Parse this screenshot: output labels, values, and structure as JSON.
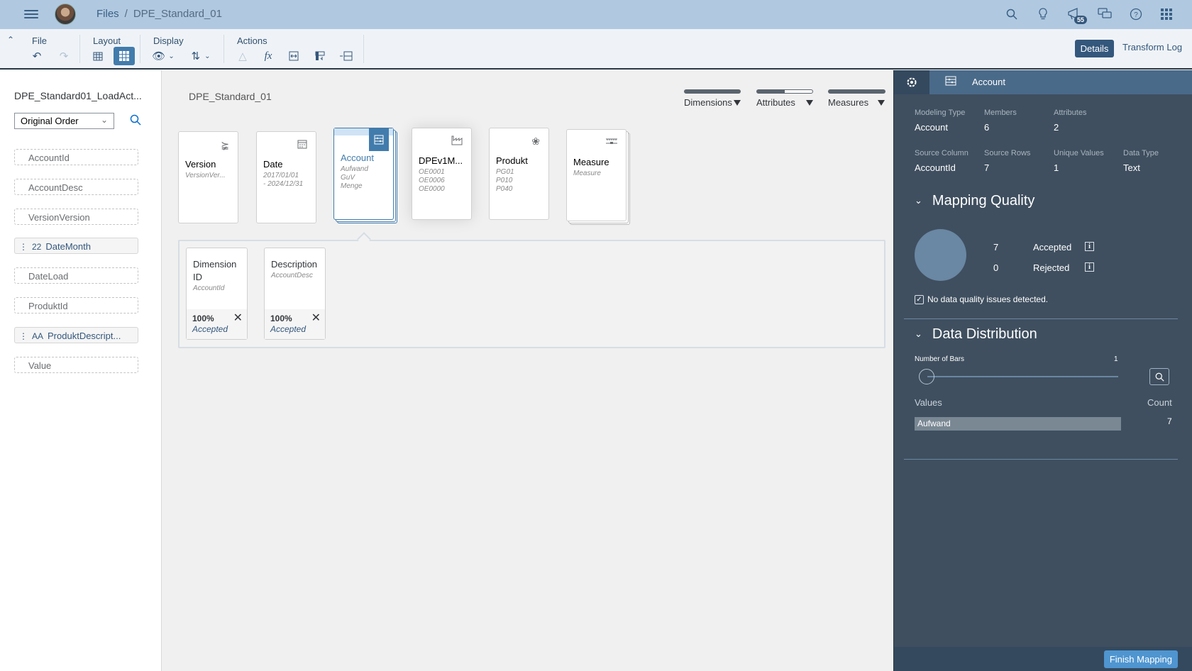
{
  "shell": {
    "breadcrumb": [
      "Files",
      "DPE_Standard_01"
    ],
    "notification_count": "55",
    "icons": [
      "search-icon",
      "lightbulb-icon",
      "megaphone-icon",
      "chat-icon",
      "help-icon",
      "app-grid-icon"
    ]
  },
  "toolbar": {
    "groups": {
      "file": "File",
      "layout": "Layout",
      "display": "Display",
      "actions": "Actions"
    },
    "details_label": "Details",
    "transform_log_label": "Transform Log"
  },
  "left_panel": {
    "title": "DPE_Standard01_LoadAct...",
    "sort_select": "Original Order",
    "fields": [
      {
        "label": "AccountId",
        "mapped": false
      },
      {
        "label": "AccountDesc",
        "mapped": false
      },
      {
        "label": "VersionVersion",
        "mapped": false
      },
      {
        "label": "DateMonth",
        "mapped": true,
        "icon": "22"
      },
      {
        "label": "DateLoad",
        "mapped": false
      },
      {
        "label": "ProduktId",
        "mapped": false
      },
      {
        "label": "ProduktDescript...",
        "mapped": true,
        "icon": "AA"
      },
      {
        "label": "Value",
        "mapped": false
      }
    ]
  },
  "canvas": {
    "title": "DPE_Standard_01",
    "legend": [
      {
        "label": "Dimensions",
        "fill": 1.0
      },
      {
        "label": "Attributes",
        "fill": 0.5
      },
      {
        "label": "Measures",
        "fill": 1.0
      }
    ],
    "cards": [
      {
        "title": "Version",
        "sub": "VersionVer...",
        "icon": "signpost-icon"
      },
      {
        "title": "Date",
        "sub": "2017/01/01\n- 2024/12/31",
        "icon": "calendar-icon"
      },
      {
        "title": "Account",
        "sub": "Aufwand\nGuV\nMenge",
        "icon": "abacus-icon",
        "selected": true
      },
      {
        "title": "DPEv1M...",
        "sub": "OE0001\nOE0006\nOE0000",
        "icon": "factory-icon"
      },
      {
        "title": "Produkt",
        "sub": "PG01\nP010\nP040",
        "icon": "product-icon"
      },
      {
        "title": "Measure",
        "sub": "Measure",
        "icon": "measure-icon"
      }
    ],
    "attributes": [
      {
        "title": "Dimension ID",
        "sub": "AccountId",
        "percent": "100%",
        "status": "Accepted"
      },
      {
        "title": "Description",
        "sub": "AccountDesc",
        "percent": "100%",
        "status": "Accepted"
      }
    ]
  },
  "details": {
    "header_title": "Account",
    "props": {
      "modeling_type_label": "Modeling Type",
      "modeling_type": "Account",
      "members_label": "Members",
      "members": "6",
      "attributes_label": "Attributes",
      "attributes": "2",
      "source_column_label": "Source Column",
      "source_column": "AccountId",
      "source_rows_label": "Source Rows",
      "source_rows": "7",
      "unique_values_label": "Unique Values",
      "unique_values": "1",
      "data_type_label": "Data Type",
      "data_type": "Text"
    },
    "mapping_quality": {
      "title": "Mapping Quality",
      "accepted_count": "7",
      "accepted_label": "Accepted",
      "rejected_count": "0",
      "rejected_label": "Rejected",
      "no_issues": "No data quality issues detected."
    },
    "data_distribution": {
      "title": "Data Distribution",
      "number_of_bars_label": "Number of Bars",
      "number_of_bars": "1",
      "values_label": "Values",
      "count_label": "Count",
      "rows": [
        {
          "value": "Aufwand",
          "count": "7"
        }
      ]
    },
    "finish_label": "Finish Mapping"
  },
  "colors": {
    "shell_bg": "#b0c9e0",
    "accent": "#427cac",
    "panel_bg": "#3f4f5f"
  }
}
